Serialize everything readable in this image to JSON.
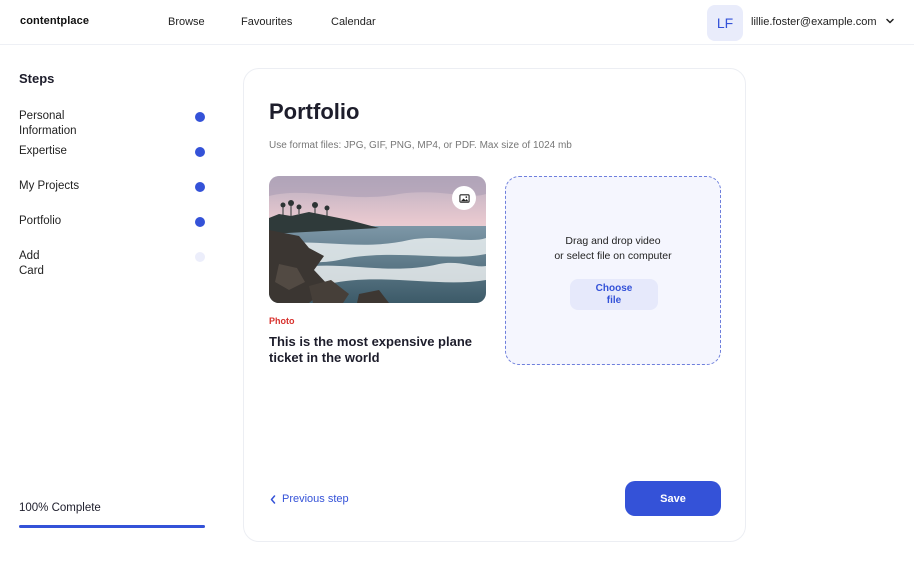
{
  "app": {
    "logo": "contentplace"
  },
  "nav": {
    "items": [
      {
        "label": "Browse"
      },
      {
        "label": "Favourites"
      },
      {
        "label": "Calendar"
      }
    ]
  },
  "user": {
    "initials": "LF",
    "email": "lillie.foster@example.com"
  },
  "sidebar": {
    "title": "Steps",
    "steps": [
      {
        "label": "Personal Information",
        "done": true
      },
      {
        "label": "Expertise",
        "done": true
      },
      {
        "label": "My Projects",
        "done": true
      },
      {
        "label": "Portfolio",
        "done": true
      },
      {
        "label": "Add Card",
        "done": false
      }
    ],
    "progress_label": "100% Complete",
    "progress_fraction": 1.0
  },
  "portfolio": {
    "title": "Portfolio",
    "subtitle": "Use format files: JPG, GIF, PNG, MP4, or PDF. Max size of 1024 mb",
    "item": {
      "tag": "Photo",
      "title": "This is the most expensive plane ticket in the world"
    },
    "dropzone": {
      "line1": "Drag and drop video",
      "line2": "or select file on computer",
      "button": "Choose file"
    },
    "prev_label": "Previous step",
    "save_label": "Save"
  },
  "colors": {
    "accent": "#3452d8",
    "tag": "#d8312d",
    "pending_dot": "#eceefb"
  }
}
